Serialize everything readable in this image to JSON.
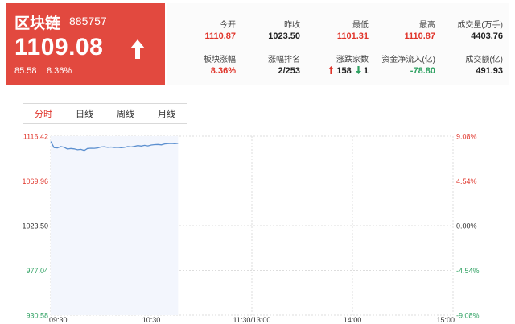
{
  "header": {
    "name": "区块链",
    "code": "885757",
    "price": "1109.08",
    "change": "85.58",
    "change_pct": "8.36%"
  },
  "stats": [
    {
      "label": "今开",
      "value": "1110.87",
      "color": "red"
    },
    {
      "label": "昨收",
      "value": "1023.50",
      "color": "dark"
    },
    {
      "label": "最低",
      "value": "1101.31",
      "color": "red"
    },
    {
      "label": "最高",
      "value": "1110.87",
      "color": "red"
    },
    {
      "label": "成交量(万手)",
      "value": "4403.76",
      "color": "dark"
    },
    {
      "label": "板块涨幅",
      "value": "8.36%",
      "color": "red"
    },
    {
      "label": "涨幅排名",
      "value": "2/253",
      "color": "dark"
    },
    {
      "label": "涨跌家数",
      "value": "",
      "color": "dark"
    },
    {
      "label": "资金净流入(亿)",
      "value": "-78.80",
      "color": "green"
    },
    {
      "label": "成交额(亿)",
      "value": "491.93",
      "color": "dark"
    }
  ],
  "updown": {
    "up": "158",
    "down": "1"
  },
  "tabs": [
    {
      "label": "分时",
      "active": true
    },
    {
      "label": "日线",
      "active": false
    },
    {
      "label": "周线",
      "active": false
    },
    {
      "label": "月线",
      "active": false
    }
  ],
  "colors": {
    "up": "#e0352b",
    "down": "#2fa162",
    "line": "#5b8fcf",
    "fill": "#f3f6fd",
    "header_bg": "#e2493f"
  },
  "chart_data": {
    "type": "line",
    "title": "",
    "xlabel": "",
    "ylabel": "",
    "x_ticks": [
      "09:30",
      "10:30",
      "11:30/13:00",
      "14:00",
      "15:00"
    ],
    "y_ticks_left": [
      "1116.42",
      "1069.96",
      "1023.50",
      "977.04",
      "930.58"
    ],
    "y_ticks_right": [
      "9.08%",
      "4.54%",
      "0.00%",
      "-4.54%",
      "-9.08%"
    ],
    "ylim": [
      930.58,
      1116.42
    ],
    "reference": 1023.5,
    "grid": true,
    "x_minutes_total": 240,
    "series": [
      {
        "x": [
          0,
          2,
          4,
          6,
          8,
          10,
          12,
          14,
          16,
          18,
          20,
          22,
          24,
          26,
          28,
          30,
          32,
          34,
          36,
          38,
          40,
          42,
          44,
          46,
          48,
          50,
          52,
          54,
          56,
          58,
          60,
          62,
          64,
          66,
          68,
          70,
          72,
          74,
          76
        ],
        "values": [
          1110.87,
          1104.5,
          1104.2,
          1105.6,
          1104.9,
          1103.0,
          1103.6,
          1103.2,
          1102.3,
          1102.7,
          1101.5,
          1103.6,
          1103.9,
          1103.8,
          1104.2,
          1105.2,
          1105.4,
          1104.8,
          1105.1,
          1104.6,
          1104.9,
          1104.4,
          1104.8,
          1105.6,
          1105.2,
          1105.9,
          1106.6,
          1106.1,
          1106.9,
          1106.3,
          1107.2,
          1107.6,
          1107.8,
          1107.4,
          1108.4,
          1108.7,
          1108.9,
          1108.6,
          1109.08
        ]
      }
    ]
  }
}
